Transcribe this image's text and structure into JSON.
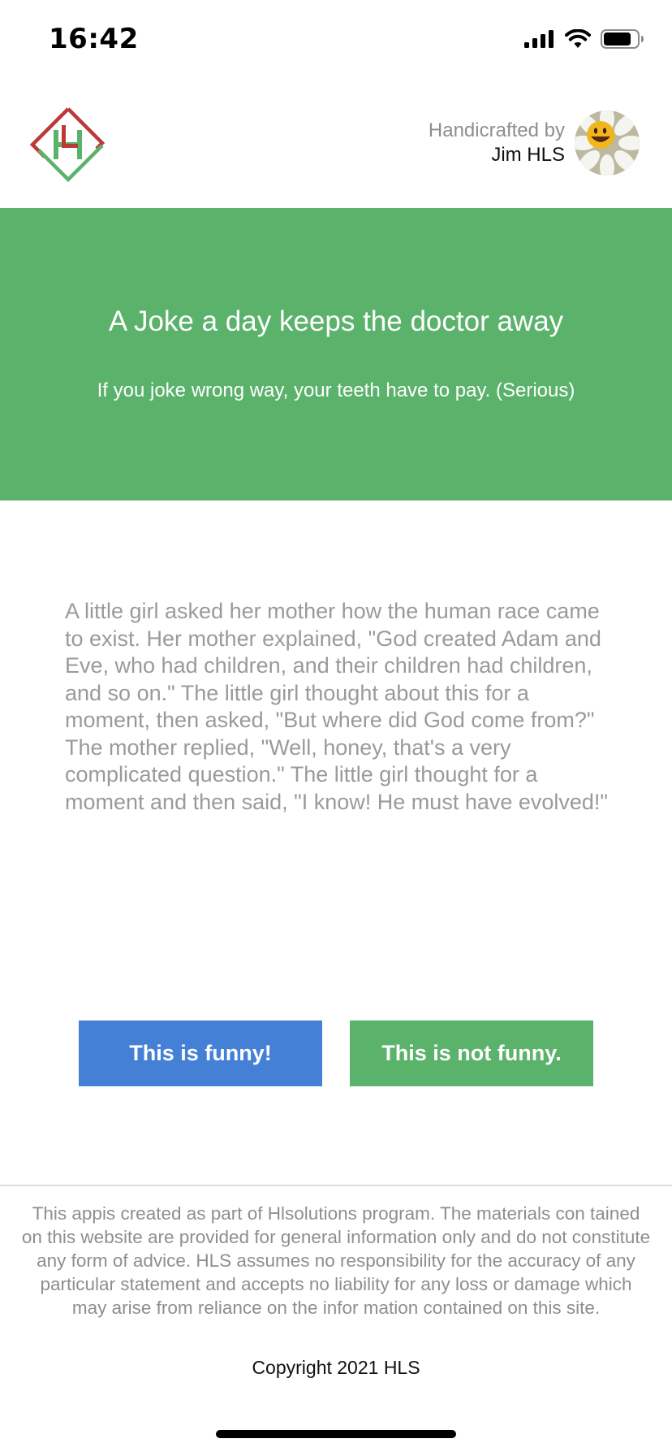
{
  "status_bar": {
    "time": "16:42"
  },
  "header": {
    "credit_prefix": "Handicrafted by",
    "credit_name": "Jim HLS"
  },
  "hero": {
    "title": "A Joke a day keeps the doctor away",
    "subtitle": "If you joke wrong way, your teeth have to pay. (Serious)"
  },
  "joke": {
    "text": "A little girl asked her mother how the human race came to exist. Her mother explained, \"God created Adam and Eve, who had children, and their children had children, and so on.\" The little girl thought about this for a moment, then asked, \"But where did God come from?\" The mother replied, \"Well, honey, that's a very complicated question.\" The little girl thought for a moment and then said, \"I know! He must have evolved!\""
  },
  "buttons": {
    "funny": "This is funny!",
    "not_funny": "This is not funny."
  },
  "footer": {
    "disclaimer": "This appis created as part of Hlsolutions program. The materials con tained on this website are provided for general information only and do not constitute any form of advice. HLS assumes no responsibility for the accuracy of any particular statement and accepts no liability for any loss or damage which may arise from reliance on the infor mation contained on this site.",
    "copyright": "Copyright 2021 HLS"
  },
  "colors": {
    "hero_bg": "#5bb26b",
    "funny_button": "#4380d6",
    "not_funny_button": "#5bb26b",
    "logo_red": "#b93a36",
    "logo_green": "#5bb26b"
  },
  "icons": {
    "signal": "cellular-signal-icon",
    "wifi": "wifi-icon",
    "battery": "battery-icon",
    "logo": "hls-logo",
    "avatar": "smiling-daisy-avatar"
  }
}
